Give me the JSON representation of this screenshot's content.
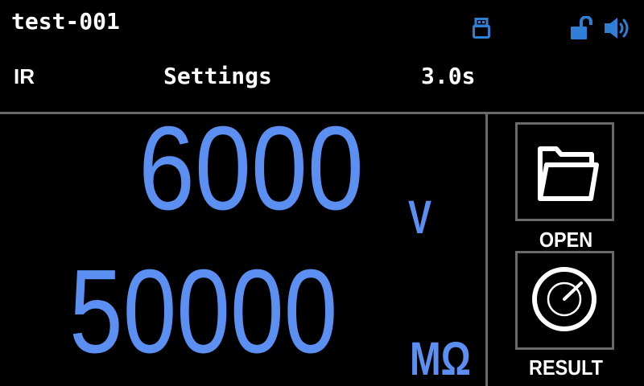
{
  "header": {
    "title": "test-001",
    "icons": {
      "usb": "usb-drive-icon",
      "lock": "unlocked-padlock-icon",
      "sound": "speaker-volume-icon"
    },
    "icon_color": "#2f7fd6"
  },
  "status": {
    "mode": "IR",
    "settings_label": "Settings",
    "time": "3.0s"
  },
  "readout": {
    "voltage": "6000",
    "voltage_unit": "V",
    "resistance": "50000",
    "resistance_unit": "MΩ",
    "color": "#5b8ff2"
  },
  "buttons": {
    "open_label": "OPEN",
    "open_icon": "folder-icon",
    "result_label": "RESULT",
    "result_icon": "gauge-dial-icon"
  },
  "colors": {
    "background": "#000000",
    "divider": "#6a6a6a",
    "text": "#ffffff"
  }
}
